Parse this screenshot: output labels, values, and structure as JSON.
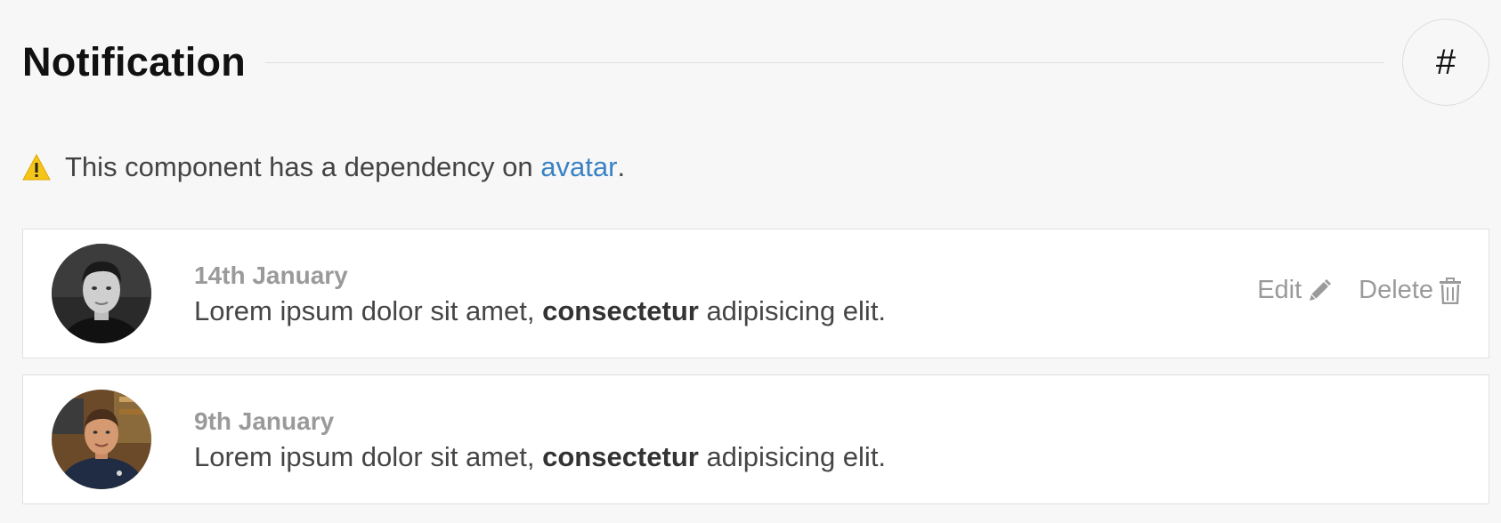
{
  "header": {
    "title": "Notification",
    "anchor_label": "#"
  },
  "dependency": {
    "prefix": "This component has a dependency on ",
    "link_text": "avatar",
    "suffix": "."
  },
  "notifications": [
    {
      "date": "14th January",
      "message_before": "Lorem ipsum dolor sit amet, ",
      "message_bold": "consectetur",
      "message_after": " adipisicing elit.",
      "actions": {
        "edit_label": "Edit",
        "delete_label": "Delete"
      }
    },
    {
      "date": "9th January",
      "message_before": "Lorem ipsum dolor sit amet, ",
      "message_bold": "consectetur",
      "message_after": " adipisicing elit."
    }
  ],
  "colors": {
    "background": "#f7f7f7",
    "link": "#3a82c4",
    "warning": "#f5c518",
    "muted_text": "#9a9a9a"
  },
  "icons": {
    "warning": "warning-icon",
    "edit": "pencil-icon",
    "delete": "trash-icon"
  }
}
